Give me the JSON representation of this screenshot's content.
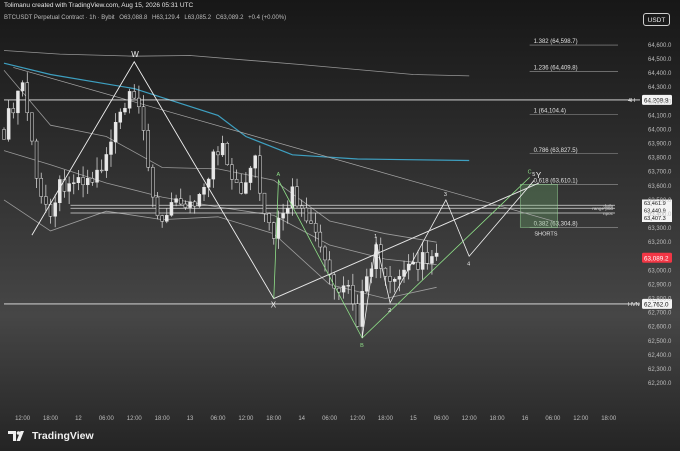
{
  "header": {
    "credit": "Tolimanu created with TradingView.com, Aug 15, 2026 05:31 UTC",
    "symbol": "BTCUSDT Perpetual Contract · 1h · Bybit",
    "ohlc": [
      "O63,088.8",
      "H63,129.4",
      "L63,085.2",
      "C63,089.2",
      "+0.4 (+0.00%)"
    ]
  },
  "currency": "USDT",
  "brand": {
    "name": "TradingView",
    "logo_icon": "tradingview-logo-icon"
  },
  "colors": {
    "candle": "#e8e8e8",
    "lower_ma": "#3fa7c9",
    "upper_ma": "#c8c8c8",
    "pattern_w": "#f0f0f0",
    "pattern_green": "#8fe088",
    "price_badge": "#f23645"
  },
  "chart_data": {
    "type": "candlestick",
    "ylim": [
      62080,
      64720
    ],
    "y_ticks": [
      64600,
      64500,
      64400,
      64300,
      64200,
      64100,
      64000,
      63900,
      63800,
      63700,
      63600,
      63500,
      63400,
      63300,
      63200,
      63100,
      63000,
      62900,
      62800,
      62700,
      62600,
      62500,
      62400,
      62300,
      62200
    ],
    "x_range": [
      "2026-08-11T08:00",
      "2026-08-16T20:00"
    ],
    "x_ticks": [
      {
        "t": "2026-08-11T12:00",
        "label": "12:00"
      },
      {
        "t": "2026-08-11T18:00",
        "label": "18:00"
      },
      {
        "t": "2026-08-12T00:00",
        "label": "12"
      },
      {
        "t": "2026-08-12T06:00",
        "label": "06:00"
      },
      {
        "t": "2026-08-12T12:00",
        "label": "12:00"
      },
      {
        "t": "2026-08-12T18:00",
        "label": "18:00"
      },
      {
        "t": "2026-08-13T00:00",
        "label": "13"
      },
      {
        "t": "2026-08-13T06:00",
        "label": "06:00"
      },
      {
        "t": "2026-08-13T12:00",
        "label": "12:00"
      },
      {
        "t": "2026-08-13T18:00",
        "label": "18:00"
      },
      {
        "t": "2026-08-14T00:00",
        "label": "14"
      },
      {
        "t": "2026-08-14T06:00",
        "label": "06:00"
      },
      {
        "t": "2026-08-14T12:00",
        "label": "12:00"
      },
      {
        "t": "2026-08-14T18:00",
        "label": "18:00"
      },
      {
        "t": "2026-08-15T00:00",
        "label": "15"
      },
      {
        "t": "2026-08-15T06:00",
        "label": "06:00"
      },
      {
        "t": "2026-08-15T12:00",
        "label": "12:00"
      },
      {
        "t": "2026-08-15T18:00",
        "label": "18:00"
      },
      {
        "t": "2026-08-16T00:00",
        "label": "16"
      },
      {
        "t": "2026-08-16T06:00",
        "label": "06:00"
      },
      {
        "t": "2026-08-16T12:00",
        "label": "12:00"
      },
      {
        "t": "2026-08-16T18:00",
        "label": "18:00"
      }
    ],
    "close_path": [
      [
        "2026-08-11T08:00",
        64000
      ],
      [
        "2026-08-11T10:00",
        64180
      ],
      [
        "2026-08-11T12:00",
        64350
      ],
      [
        "2026-08-11T14:00",
        63900
      ],
      [
        "2026-08-11T16:00",
        63500
      ],
      [
        "2026-08-11T18:00",
        63450
      ],
      [
        "2026-08-11T20:00",
        63600
      ],
      [
        "2026-08-11T22:00",
        63660
      ],
      [
        "2026-08-12T00:00",
        63600
      ],
      [
        "2026-08-12T03:00",
        63650
      ],
      [
        "2026-08-12T05:00",
        63700
      ],
      [
        "2026-08-12T07:00",
        63900
      ],
      [
        "2026-08-12T09:00",
        64100
      ],
      [
        "2026-08-12T11:00",
        64200
      ],
      [
        "2026-08-12T13:00",
        64150
      ],
      [
        "2026-08-12T15:00",
        63700
      ],
      [
        "2026-08-12T17:00",
        63400
      ],
      [
        "2026-08-12T19:00",
        63380
      ],
      [
        "2026-08-12T21:00",
        63450
      ],
      [
        "2026-08-13T00:00",
        63500
      ],
      [
        "2026-08-13T03:00",
        63550
      ],
      [
        "2026-08-13T05:00",
        63800
      ],
      [
        "2026-08-13T07:00",
        63900
      ],
      [
        "2026-08-13T09:00",
        63700
      ],
      [
        "2026-08-13T11:00",
        63600
      ],
      [
        "2026-08-13T14:00",
        63800
      ],
      [
        "2026-08-13T16:00",
        63400
      ],
      [
        "2026-08-13T18:00",
        63200
      ],
      [
        "2026-08-13T20:00",
        63450
      ],
      [
        "2026-08-13T22:00",
        63550
      ],
      [
        "2026-08-14T00:00",
        63500
      ],
      [
        "2026-08-14T02:00",
        63320
      ],
      [
        "2026-08-14T04:00",
        63150
      ],
      [
        "2026-08-14T06:00",
        62950
      ],
      [
        "2026-08-14T08:00",
        62800
      ],
      [
        "2026-08-14T10:00",
        62850
      ],
      [
        "2026-08-14T12:00",
        62650
      ],
      [
        "2026-08-14T14:00",
        63000
      ],
      [
        "2026-08-14T16:00",
        63150
      ],
      [
        "2026-08-14T18:00",
        62900
      ],
      [
        "2026-08-14T20:00",
        62880
      ],
      [
        "2026-08-14T22:00",
        63000
      ],
      [
        "2026-08-15T00:00",
        63050
      ],
      [
        "2026-08-15T03:00",
        63100
      ],
      [
        "2026-08-15T05:00",
        63089
      ]
    ],
    "series": [
      {
        "points": [
          [
            "2026-08-11T08:00",
            64560
          ],
          [
            "2026-08-11T20:00",
            64535
          ],
          [
            "2026-08-12T12:00",
            64520
          ],
          [
            "2026-08-13T00:00",
            64525
          ],
          [
            "2026-08-14T00:00",
            64460
          ],
          [
            "2026-08-15T00:00",
            64390
          ],
          [
            "2026-08-15T12:00",
            64380
          ]
        ]
      },
      {
        "points": [
          [
            "2026-08-11T08:00",
            64470
          ],
          [
            "2026-08-11T18:00",
            64390
          ],
          [
            "2026-08-12T12:00",
            64290
          ],
          [
            "2026-08-13T06:00",
            64100
          ],
          [
            "2026-08-13T12:00",
            63950
          ],
          [
            "2026-08-13T22:00",
            63820
          ],
          [
            "2026-08-14T12:00",
            63790
          ],
          [
            "2026-08-15T12:00",
            63780
          ]
        ]
      },
      {
        "points": [
          [
            "2026-08-11T08:00",
            64420
          ],
          [
            "2026-08-11T18:00",
            64030
          ],
          [
            "2026-08-12T06:00",
            63950
          ],
          [
            "2026-08-12T18:00",
            63730
          ],
          [
            "2026-08-13T06:00",
            63720
          ],
          [
            "2026-08-13T18:00",
            63640
          ],
          [
            "2026-08-14T06:00",
            63350
          ],
          [
            "2026-08-14T18:00",
            63260
          ],
          [
            "2026-08-15T05:00",
            63200
          ]
        ]
      },
      {
        "points": [
          [
            "2026-08-11T08:00",
            63850
          ],
          [
            "2026-08-11T18:00",
            63750
          ],
          [
            "2026-08-12T06:00",
            63620
          ],
          [
            "2026-08-12T18:00",
            63520
          ],
          [
            "2026-08-13T06:00",
            63450
          ],
          [
            "2026-08-13T18:00",
            63390
          ],
          [
            "2026-08-14T06:00",
            63180
          ],
          [
            "2026-08-14T18:00",
            63080
          ],
          [
            "2026-08-15T05:00",
            63040
          ]
        ]
      },
      {
        "points": [
          [
            "2026-08-11T08:00",
            63500
          ],
          [
            "2026-08-11T18:00",
            63280
          ],
          [
            "2026-08-12T06:00",
            63420
          ],
          [
            "2026-08-12T18:00",
            63360
          ],
          [
            "2026-08-13T06:00",
            63380
          ],
          [
            "2026-08-13T18:00",
            63260
          ],
          [
            "2026-08-14T06:00",
            62900
          ],
          [
            "2026-08-14T18:00",
            62800
          ],
          [
            "2026-08-15T05:00",
            62880
          ]
        ]
      }
    ],
    "levels": [
      {
        "label": "1.382 (64,598.7)",
        "price": 64598.7
      },
      {
        "label": "1.236 (64,409.8)",
        "price": 64409.8
      },
      {
        "label": "1 (64,104.4)",
        "price": 64104.4
      },
      {
        "label": "0.786 (63,827.5)",
        "price": 63827.5
      },
      {
        "label": "0.618 (63,610.1)",
        "price": 63610.1
      },
      {
        "label": "0.382 (63,304.8)",
        "price": 63304.8
      }
    ],
    "hlines": [
      {
        "tag": "4H",
        "price": 64209.8,
        "badge": "64,209.8"
      },
      {
        "tag": "HVN",
        "price": 62762.0,
        "badge": "62,762.0"
      }
    ],
    "small_lines": [
      {
        "label": "daily",
        "price": 63461.9
      },
      {
        "label": "range pod",
        "price": 63440.9
      },
      {
        "label": "npoc",
        "price": 63407.3
      }
    ],
    "right_badges": [
      "63,461.9",
      "63,440.9",
      "63,407.3"
    ],
    "current_price": {
      "value": 63089.2,
      "label": "63,089.2"
    },
    "zone": {
      "label": "SHORTS",
      "t0": "2026-08-15T23:00",
      "t1": "2026-08-16T07:00",
      "p0": 63304.8,
      "p1": 63610.1
    },
    "pattern_w": [
      {
        "label": "W",
        "t": "2026-08-12T12:00",
        "p": 64480
      },
      {
        "label": "X",
        "t": "2026-08-13T18:00",
        "p": 62800
      },
      {
        "label": "Y",
        "t": "2026-08-16T03:00",
        "p": 63620
      }
    ],
    "pattern_abc": [
      {
        "label": "A",
        "t": "2026-08-13T19:00",
        "p": 63640
      },
      {
        "label": "B",
        "t": "2026-08-14T13:00",
        "p": 62520
      },
      {
        "label": "C",
        "t": "2026-08-16T01:00",
        "p": 63660
      }
    ],
    "pattern_proj": [
      {
        "label": "",
        "t": "2026-08-14T13:00",
        "p": 62520
      },
      {
        "label": "1",
        "t": "2026-08-14T16:00",
        "p": 63200
      },
      {
        "label": "2",
        "t": "2026-08-14T19:00",
        "p": 62770
      },
      {
        "label": "3",
        "t": "2026-08-15T07:00",
        "p": 63500
      },
      {
        "label": "4",
        "t": "2026-08-15T12:00",
        "p": 63100
      },
      {
        "label": "5",
        "t": "2026-08-16T02:00",
        "p": 63640
      }
    ],
    "trendline": [
      [
        "2026-08-11T10:00",
        64440
      ],
      [
        "2026-08-16T06:00",
        63350
      ]
    ],
    "support_line": [
      [
        "2026-08-13T18:00",
        62800
      ],
      [
        "2026-08-16T03:00",
        63620
      ]
    ]
  }
}
